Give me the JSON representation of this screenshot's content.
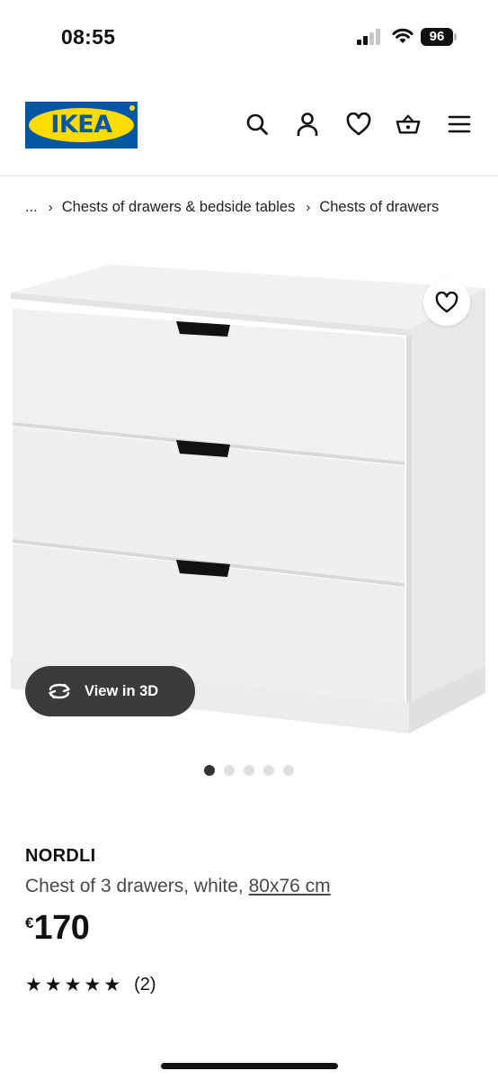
{
  "status_bar": {
    "time": "08:55",
    "battery": "96"
  },
  "header": {
    "logo_text": "IKEA",
    "icons": [
      "search-icon",
      "account-icon",
      "favourites-icon",
      "basket-icon",
      "menu-icon"
    ]
  },
  "breadcrumb": {
    "ellipsis": "...",
    "items": [
      "Chests of drawers & bedside tables",
      "Chests of drawers"
    ]
  },
  "gallery": {
    "view_3d_label": "View in 3D",
    "image_count": 5,
    "active_index": 0
  },
  "product": {
    "name": "NORDLI",
    "description": "Chest of 3 drawers, white, ",
    "size_link": "80x76 cm",
    "currency": "€",
    "price": "170",
    "rating_stars": 5,
    "review_count": "(2)"
  },
  "colors": {
    "ikea_blue": "#0058a3",
    "ikea_yellow": "#ffdb00",
    "view3d_bg": "#3b3b3b"
  }
}
